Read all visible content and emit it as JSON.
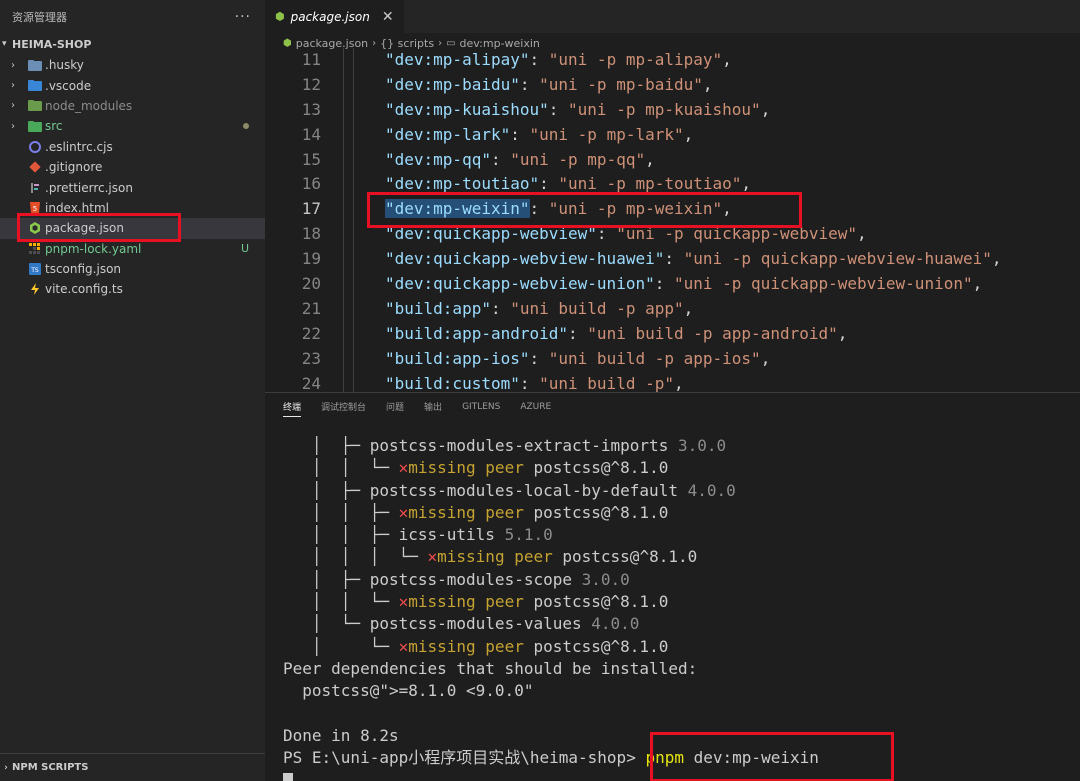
{
  "sidebar": {
    "title": "资源管理器",
    "more": "···",
    "project": "HEIMA-SHOP",
    "items": [
      {
        "name": ".husky",
        "kind": "folder"
      },
      {
        "name": ".vscode",
        "kind": "folder"
      },
      {
        "name": "node_modules",
        "kind": "folder"
      },
      {
        "name": "src",
        "kind": "folder"
      },
      {
        "name": ".eslintrc.cjs",
        "kind": "file"
      },
      {
        "name": ".gitignore",
        "kind": "file"
      },
      {
        "name": ".prettierrc.json",
        "kind": "file"
      },
      {
        "name": "index.html",
        "kind": "file"
      },
      {
        "name": "package.json",
        "kind": "file"
      },
      {
        "name": "pnpm-lock.yaml",
        "kind": "file",
        "badge": "U"
      },
      {
        "name": "tsconfig.json",
        "kind": "file"
      },
      {
        "name": "vite.config.ts",
        "kind": "file"
      }
    ],
    "footer": "NPM SCRIPTS"
  },
  "editor": {
    "tab": {
      "label": "package.json",
      "close": "✕"
    },
    "breadcrumb": [
      "package.json",
      "{} scripts",
      "dev:mp-weixin"
    ],
    "lines": [
      {
        "num": "11",
        "key": "\"dev:mp-alipay\"",
        "val": "\"uni -p mp-alipay\""
      },
      {
        "num": "12",
        "key": "\"dev:mp-baidu\"",
        "val": "\"uni -p mp-baidu\""
      },
      {
        "num": "13",
        "key": "\"dev:mp-kuaishou\"",
        "val": "\"uni -p mp-kuaishou\""
      },
      {
        "num": "14",
        "key": "\"dev:mp-lark\"",
        "val": "\"uni -p mp-lark\""
      },
      {
        "num": "15",
        "key": "\"dev:mp-qq\"",
        "val": "\"uni -p mp-qq\""
      },
      {
        "num": "16",
        "key": "\"dev:mp-toutiao\"",
        "val": "\"uni -p mp-toutiao\""
      },
      {
        "num": "17",
        "key": "\"dev:mp-weixin\"",
        "val": "\"uni -p mp-weixin\""
      },
      {
        "num": "18",
        "key": "\"dev:quickapp-webview\"",
        "val": "\"uni -p quickapp-webview\""
      },
      {
        "num": "19",
        "key": "\"dev:quickapp-webview-huawei\"",
        "val": "\"uni -p quickapp-webview-huawei\""
      },
      {
        "num": "20",
        "key": "\"dev:quickapp-webview-union\"",
        "val": "\"uni -p quickapp-webview-union\""
      },
      {
        "num": "21",
        "key": "\"build:app\"",
        "val": "\"uni build -p app\""
      },
      {
        "num": "22",
        "key": "\"build:app-android\"",
        "val": "\"uni build -p app-android\""
      },
      {
        "num": "23",
        "key": "\"build:app-ios\"",
        "val": "\"uni build -p app-ios\""
      },
      {
        "num": "24",
        "key": "\"build:custom\"",
        "val": "\"uni build -p\""
      }
    ]
  },
  "panel": {
    "tabs": [
      "终端",
      "调试控制台",
      "问题",
      "输出",
      "GITLENS",
      "AZURE"
    ],
    "terminal": {
      "tree": [
        {
          "prefix": "   │  ├─ ",
          "pkg": "postcss-modules-extract-imports",
          "ver": "3.0.0"
        },
        {
          "prefix": "   │  │  └─ ",
          "missing": true
        },
        {
          "prefix": "   │  ├─ ",
          "pkg": "postcss-modules-local-by-default",
          "ver": "4.0.0"
        },
        {
          "prefix": "   │  │  ├─ ",
          "missing": true
        },
        {
          "prefix": "   │  │  ├─ ",
          "pkg": "icss-utils",
          "ver": "5.1.0"
        },
        {
          "prefix": "   │  │  │  └─ ",
          "missing": true
        },
        {
          "prefix": "   │  ├─ ",
          "pkg": "postcss-modules-scope",
          "ver": "3.0.0"
        },
        {
          "prefix": "   │  │  └─ ",
          "missing": true
        },
        {
          "prefix": "   │  └─ ",
          "pkg": "postcss-modules-values",
          "ver": "4.0.0"
        },
        {
          "prefix": "   │     └─ ",
          "missing": true
        }
      ],
      "missing_mark": "✕",
      "missing_text": "missing peer",
      "missing_pkg": "postcss@^8.1.0",
      "peer_header": "Peer dependencies that should be installed:",
      "peer_line": "  postcss@\">=8.1.0 <9.0.0\"",
      "done": "Done in 8.2s",
      "prompt": "PS E:\\uni-app小程序项目实战\\heima-shop> ",
      "cmd_name": "pnpm",
      "cmd_args": " dev:mp-weixin"
    }
  },
  "colors": {
    "highlight_box": "#e81123",
    "json_key": "#9cdcfe",
    "json_string": "#ce9178"
  }
}
